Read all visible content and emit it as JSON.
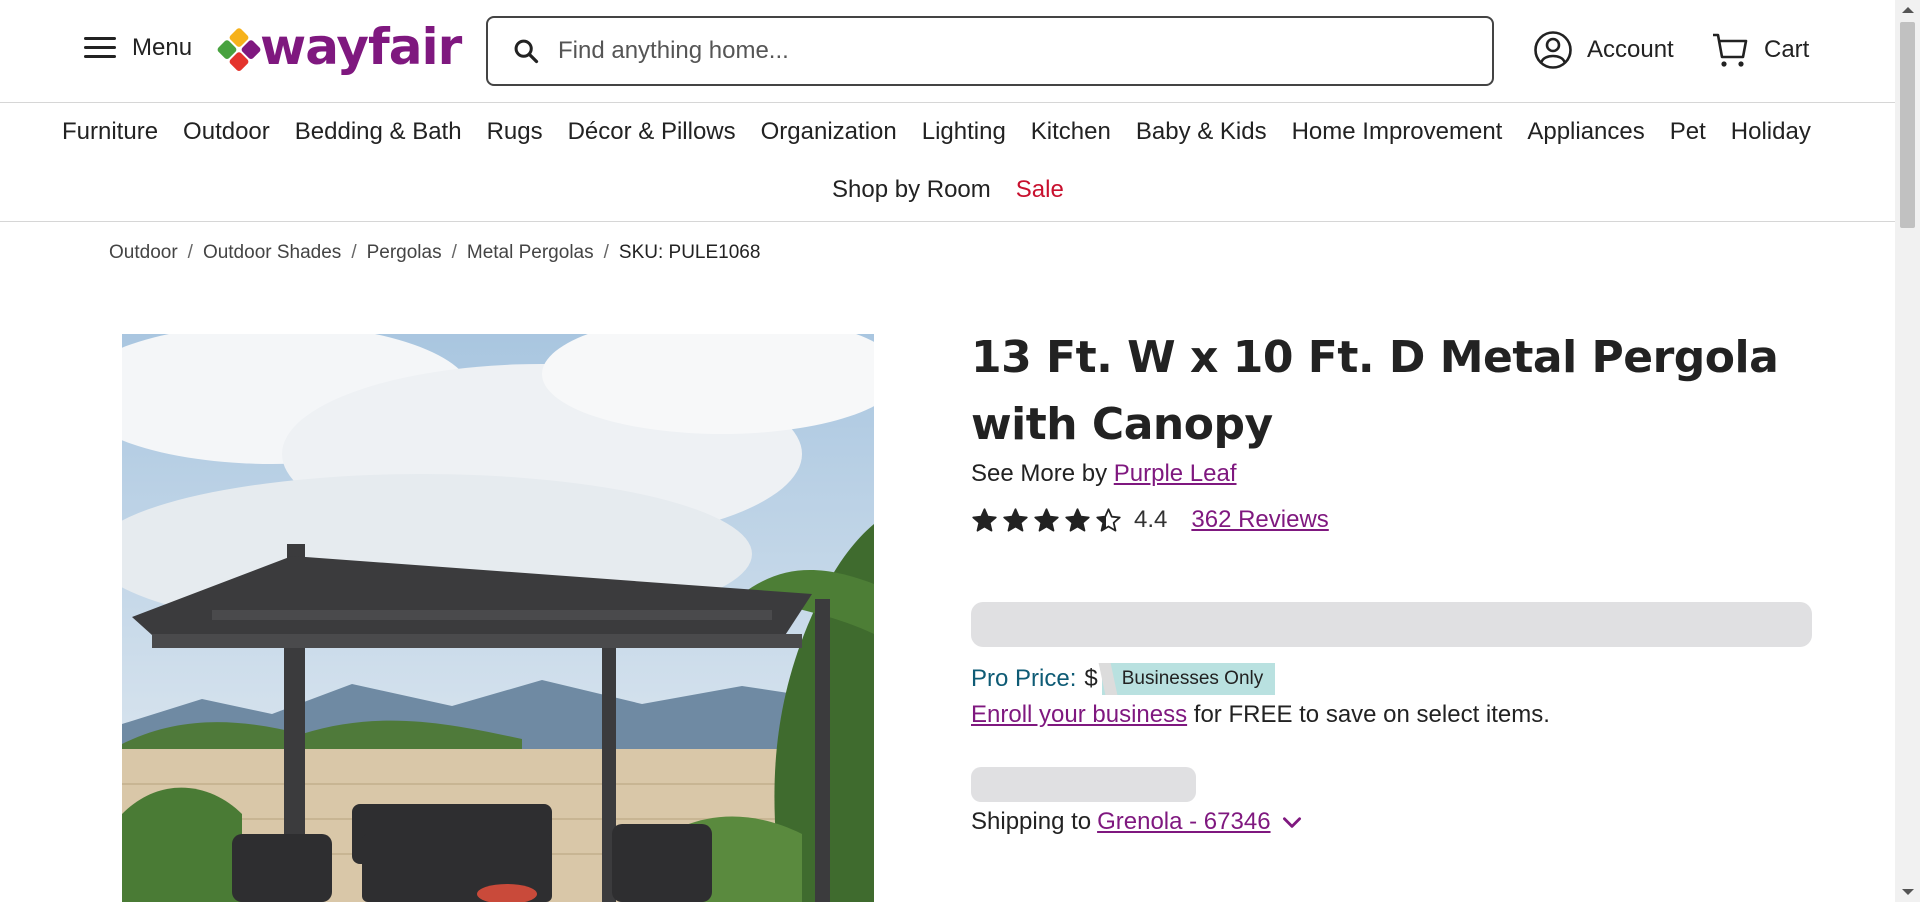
{
  "header": {
    "menu_label": "Menu",
    "logo_text": "wayfair",
    "search_placeholder": "Find anything home...",
    "account_label": "Account",
    "cart_label": "Cart"
  },
  "nav": {
    "row1": [
      "Furniture",
      "Outdoor",
      "Bedding & Bath",
      "Rugs",
      "Décor & Pillows",
      "Organization",
      "Lighting",
      "Kitchen",
      "Baby & Kids",
      "Home Improvement",
      "Appliances",
      "Pet",
      "Holiday"
    ],
    "shop_by_room": "Shop by Room",
    "sale": "Sale"
  },
  "breadcrumb": {
    "items": [
      "Outdoor",
      "Outdoor Shades",
      "Pergolas",
      "Metal Pergolas"
    ],
    "separator": "/",
    "sku": "SKU: PULE1068"
  },
  "product": {
    "title": "13 Ft. W x 10 Ft. D Metal Pergola with Canopy",
    "see_more_prefix": "See More by",
    "brand": "Purple Leaf",
    "rating": "4.4",
    "rating_value": 4.4,
    "rating_max": 5,
    "reviews": "362 Reviews",
    "pro_price_label": "Pro Price:",
    "pro_price_dollar": "$",
    "businesses_only": "Businesses Only",
    "enroll_link": "Enroll your business",
    "enroll_suffix": "for FREE to save on select items.",
    "shipping_prefix": "Shipping to",
    "shipping_location": "Grenola - 67346"
  },
  "colors": {
    "brand": "#7f187f",
    "sale": "#c8102e",
    "pro": "#0e5b75",
    "tag_bg": "#b9e1e0"
  }
}
